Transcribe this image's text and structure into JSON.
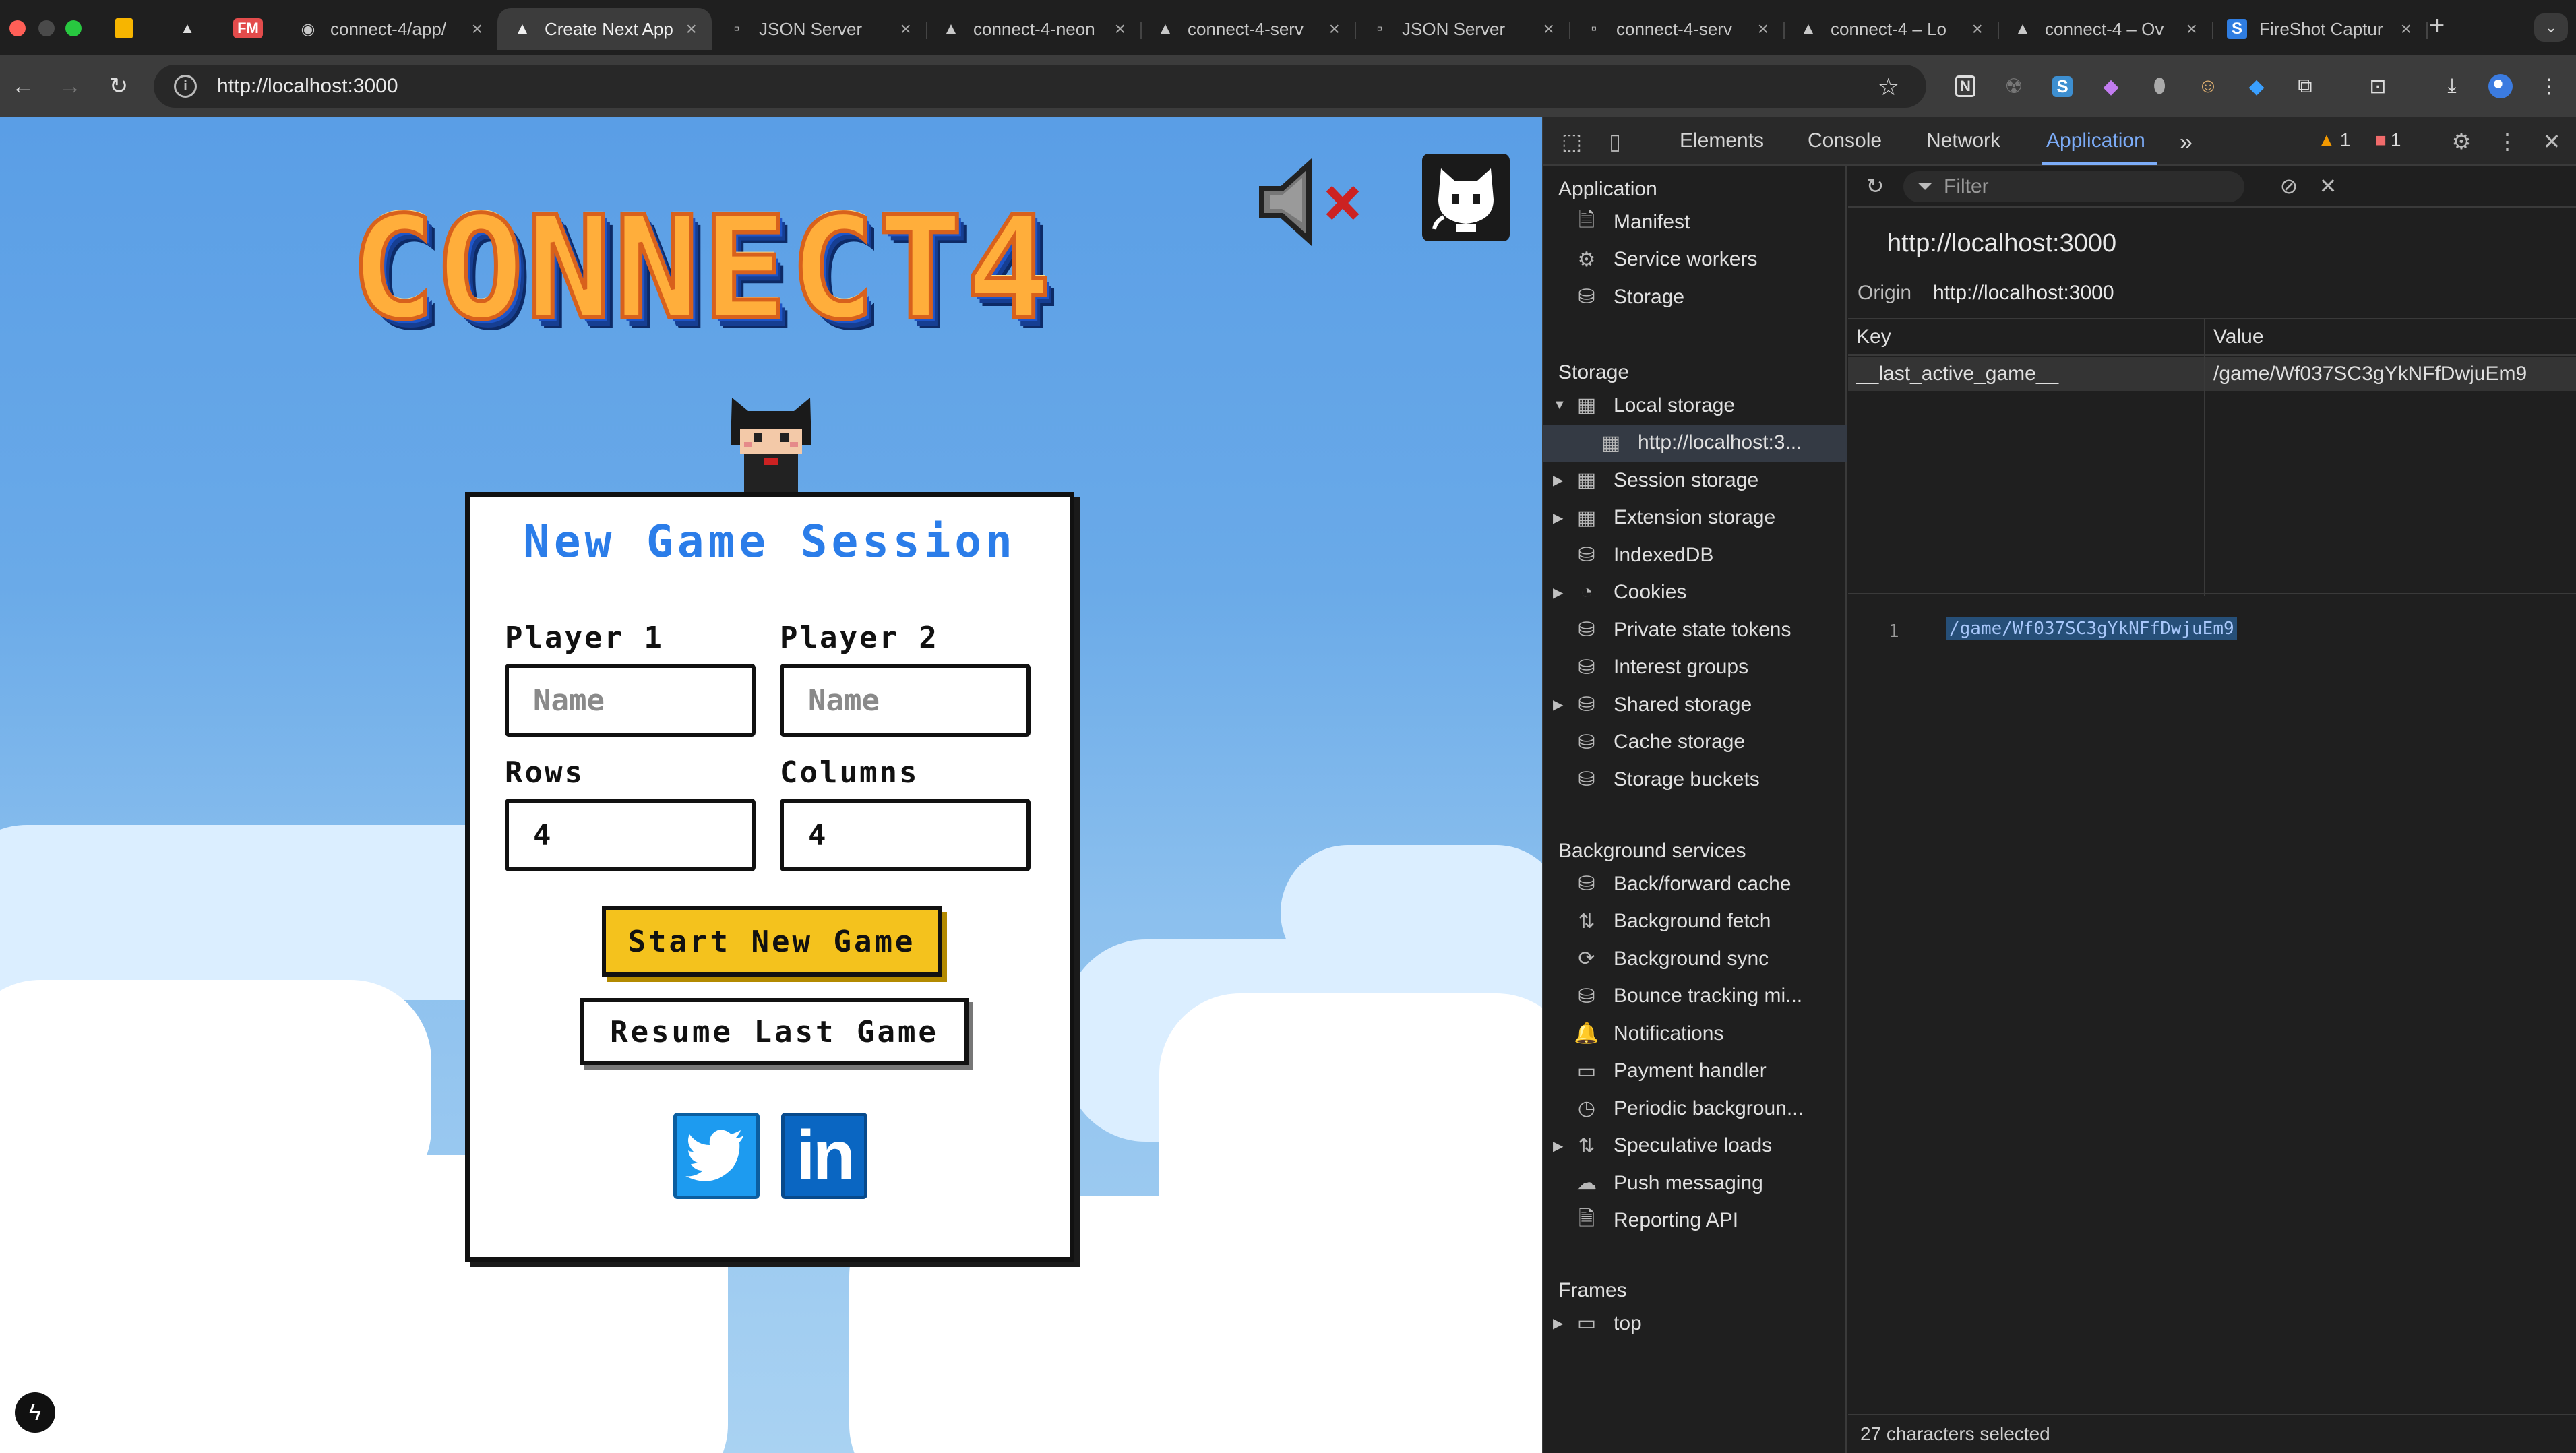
{
  "browser": {
    "pinned_tabs": [
      "keep-icon",
      "vercel-icon",
      "fm-icon"
    ],
    "pinned_fm_label": "FM",
    "tabs": [
      {
        "title": "connect-4/app/",
        "icon": "github-icon",
        "active": false
      },
      {
        "title": "Create Next App",
        "icon": "vercel-icon",
        "active": true
      },
      {
        "title": "JSON Server",
        "icon": "server-icon",
        "active": false
      },
      {
        "title": "connect-4-neon",
        "icon": "vercel-icon",
        "active": false
      },
      {
        "title": "connect-4-serv",
        "icon": "vercel-icon",
        "active": false
      },
      {
        "title": "JSON Server",
        "icon": "server-icon",
        "active": false
      },
      {
        "title": "connect-4-serv",
        "icon": "server-icon",
        "active": false
      },
      {
        "title": "connect-4 – Lo",
        "icon": "vercel-icon",
        "active": false
      },
      {
        "title": "connect-4 – Ov",
        "icon": "vercel-icon",
        "active": false
      },
      {
        "title": "FireShot Captur",
        "icon": "fireshot-icon",
        "active": false
      }
    ],
    "new_tab_label": "+",
    "url": "http://localhost:3000"
  },
  "game": {
    "logo_text": "CONNECT4",
    "card_title": "New Game Session",
    "player1_label": "Player 1",
    "player2_label": "Player 2",
    "player1_placeholder": "Name",
    "player2_placeholder": "Name",
    "rows_label": "Rows",
    "columns_label": "Columns",
    "rows_value": "4",
    "columns_value": "4",
    "start_button": "Start New Game",
    "resume_button": "Resume Last Game",
    "linkedin_text": "in"
  },
  "devtools": {
    "tabs": [
      "Elements",
      "Console",
      "Network",
      "Application"
    ],
    "active_tab": "Application",
    "more_tabs": "»",
    "warning_count": "1",
    "error_count": "1",
    "sidebar": {
      "sections": [
        {
          "title": "Application",
          "items": [
            {
              "label": "Manifest",
              "icon": "document-icon",
              "arrow": false
            },
            {
              "label": "Service workers",
              "icon": "gears-icon",
              "arrow": false
            },
            {
              "label": "Storage",
              "icon": "database-icon",
              "arrow": false
            }
          ]
        },
        {
          "title": "Storage",
          "items": [
            {
              "label": "Local storage",
              "icon": "table-icon",
              "arrow": "down"
            },
            {
              "label": "http://localhost:3...",
              "icon": "table-icon",
              "arrow": false,
              "selected": true,
              "indent": true
            },
            {
              "label": "Session storage",
              "icon": "table-icon",
              "arrow": "right"
            },
            {
              "label": "Extension storage",
              "icon": "table-icon",
              "arrow": "right"
            },
            {
              "label": "IndexedDB",
              "icon": "database-icon",
              "arrow": false
            },
            {
              "label": "Cookies",
              "icon": "cookie-icon",
              "arrow": "right"
            },
            {
              "label": "Private state tokens",
              "icon": "database-icon",
              "arrow": false
            },
            {
              "label": "Interest groups",
              "icon": "database-icon",
              "arrow": false
            },
            {
              "label": "Shared storage",
              "icon": "database-icon",
              "arrow": "right"
            },
            {
              "label": "Cache storage",
              "icon": "database-icon",
              "arrow": false
            },
            {
              "label": "Storage buckets",
              "icon": "database-icon",
              "arrow": false
            }
          ]
        },
        {
          "title": "Background services",
          "items": [
            {
              "label": "Back/forward cache",
              "icon": "database-icon",
              "arrow": false
            },
            {
              "label": "Background fetch",
              "icon": "updown-arrows-icon",
              "arrow": false
            },
            {
              "label": "Background sync",
              "icon": "sync-icon",
              "arrow": false
            },
            {
              "label": "Bounce tracking mi...",
              "icon": "database-icon",
              "arrow": false
            },
            {
              "label": "Notifications",
              "icon": "bell-icon",
              "arrow": false
            },
            {
              "label": "Payment handler",
              "icon": "card-icon",
              "arrow": false
            },
            {
              "label": "Periodic backgroun...",
              "icon": "clock-icon",
              "arrow": false
            },
            {
              "label": "Speculative loads",
              "icon": "updown-arrows-icon",
              "arrow": "right"
            },
            {
              "label": "Push messaging",
              "icon": "cloud-icon",
              "arrow": false
            },
            {
              "label": "Reporting API",
              "icon": "document-icon",
              "arrow": false
            }
          ]
        },
        {
          "title": "Frames",
          "items": [
            {
              "label": "top",
              "icon": "frame-icon",
              "arrow": "right"
            }
          ]
        }
      ]
    },
    "filter_placeholder": "Filter",
    "origin_title": "http://localhost:3000",
    "origin_label": "Origin",
    "origin_value": "http://localhost:3000",
    "table": {
      "key_header": "Key",
      "value_header": "Value",
      "rows": [
        {
          "key": "__last_active_game__",
          "value": "/game/Wf037SC3gYkNFfDwjuEm9"
        }
      ]
    },
    "preview_line": "1",
    "preview_value": "/game/Wf037SC3gYkNFfDwjuEm9",
    "status": "27 characters selected"
  }
}
